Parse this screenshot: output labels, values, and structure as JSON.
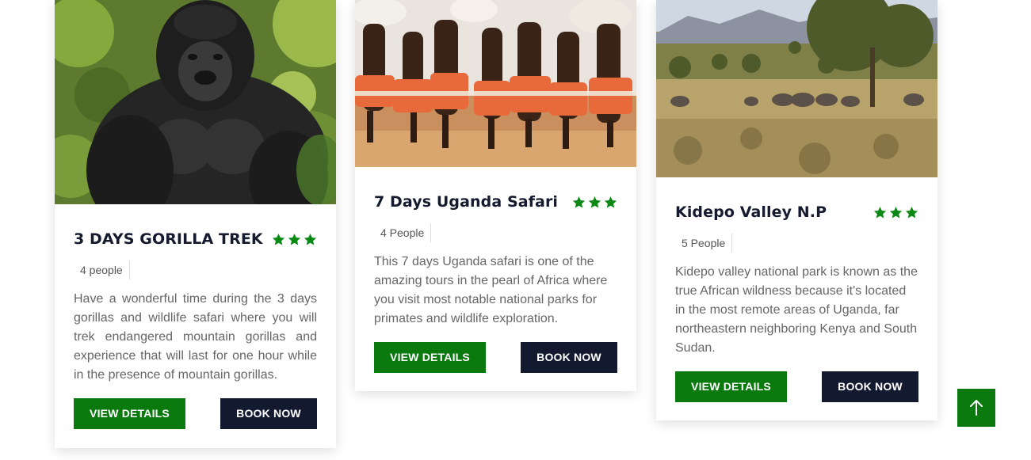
{
  "colors": {
    "accent_green": "#0a7a0f",
    "star_green": "#0a8a14",
    "dark_navy": "#131a30",
    "title_color": "#151a2e",
    "text_gray": "#666666"
  },
  "tours": [
    {
      "image": "mountain-gorilla-photo",
      "title": "3 DAYS GORILLA TREK",
      "rating_stars": 3,
      "people": "4 people",
      "description": "Have a wonderful time during the 3 days gorillas and wildlife safari where you will trek endangered mountain gorillas and experience that will last for one hour while in the presence of mountain gorillas.",
      "details_label": "VIEW DETAILS",
      "book_label": "BOOK NOW"
    },
    {
      "image": "traditional-dancers-photo",
      "title": "7 Days Uganda Safari",
      "rating_stars": 3,
      "people": "4 People",
      "description": "This 7 days Uganda safari is one of the amazing tours in the pearl of Africa where you visit most notable national parks for primates and wildlife exploration.",
      "details_label": "VIEW DETAILS",
      "book_label": "BOOK NOW"
    },
    {
      "image": "savanna-elephants-photo",
      "title": "Kidepo Valley N.P",
      "rating_stars": 3,
      "people": "5 People",
      "description": "Kidepo valley national park is known as the true African wildness because it's located in the most remote areas of Uganda, far northeastern neighboring Kenya and South Sudan.",
      "details_label": "VIEW DETAILS",
      "book_label": "BOOK NOW"
    }
  ],
  "back_to_top": {
    "icon": "arrow-up-icon"
  }
}
